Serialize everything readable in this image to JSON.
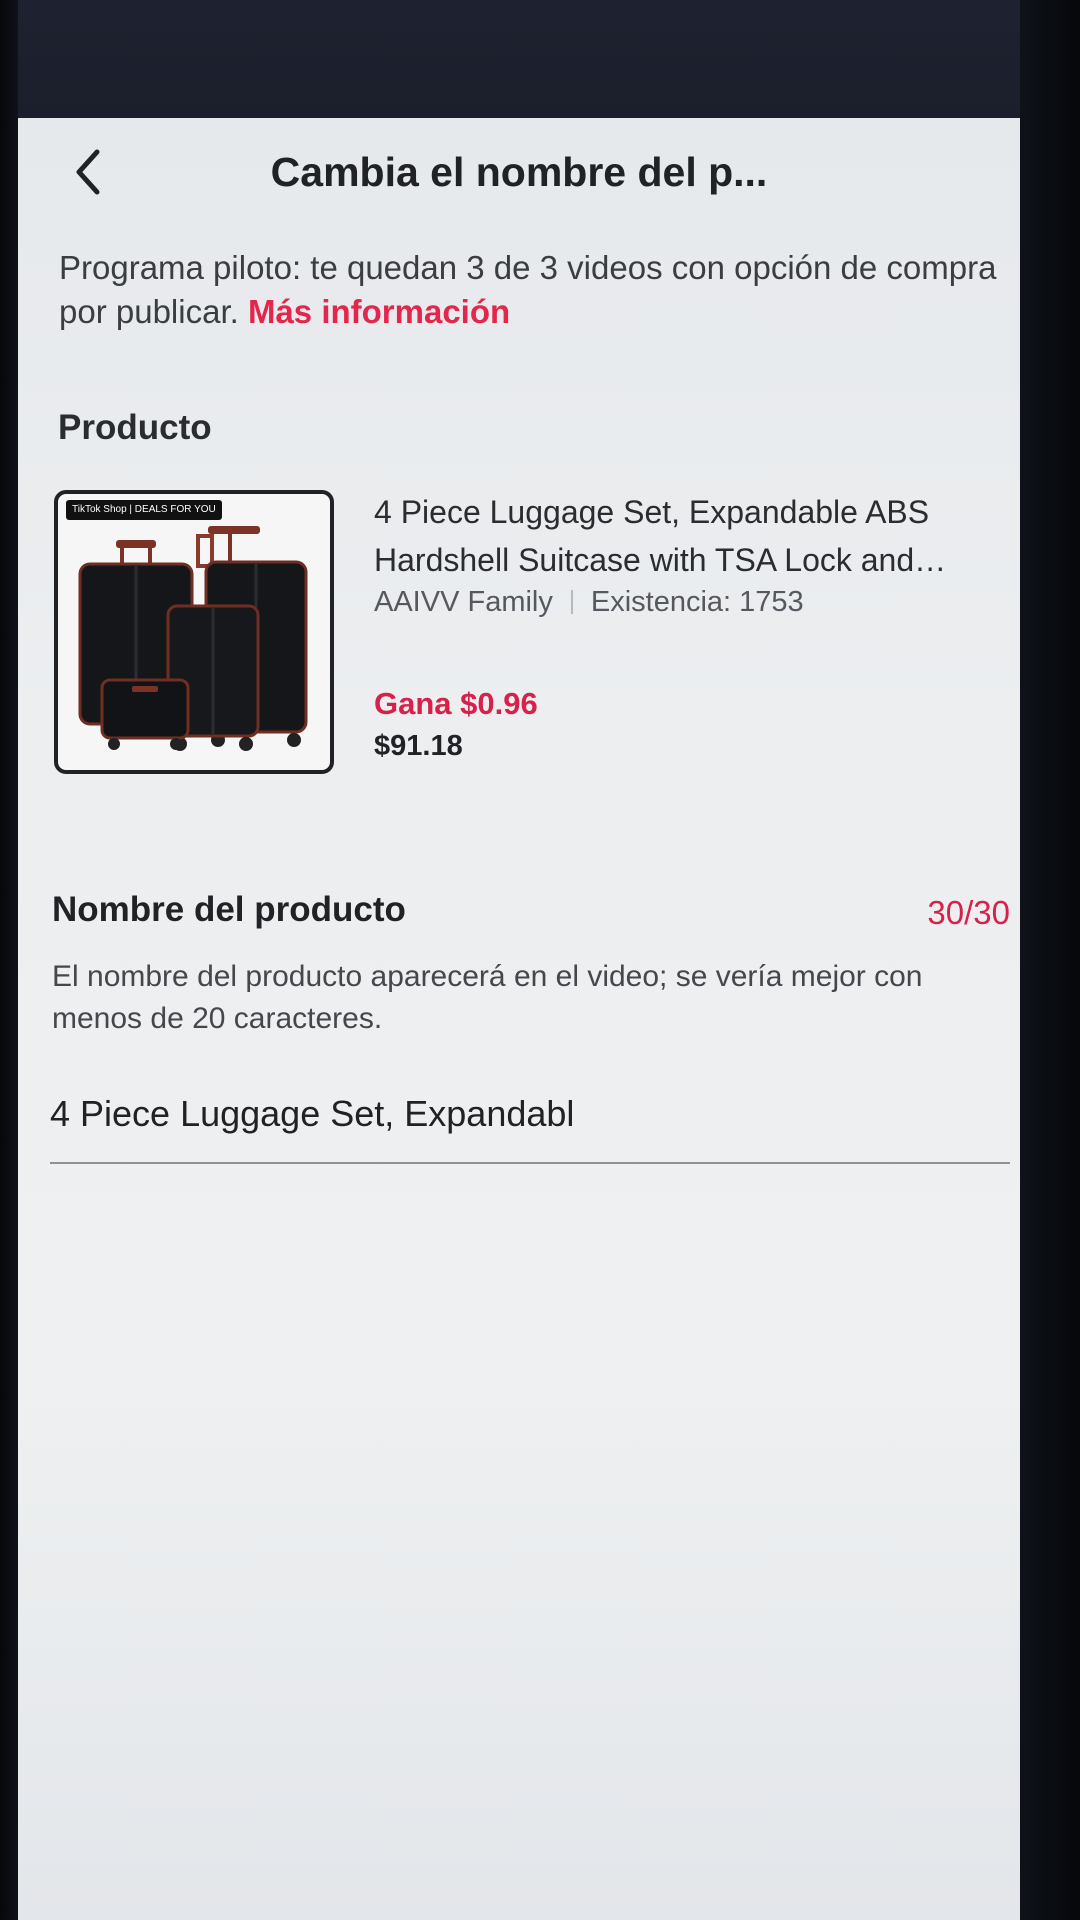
{
  "header": {
    "title": "Cambia el nombre del p...",
    "back_icon": "chevron-left-icon"
  },
  "notice": {
    "text": "Programa piloto: te quedan 3 de 3 videos con opción de compra por publicar. ",
    "link": "Más información",
    "link_color": "#e3264c"
  },
  "product_section": {
    "title": "Producto",
    "thumbnail": {
      "banner": "TikTok Shop | DEALS FOR YOU",
      "image": "luggage-set-image"
    },
    "name": "4 Piece Luggage Set, Expandable ABS Hardshell Suitcase with TSA Lock and…",
    "seller": "AAIVV Family",
    "stock": "Existencia: 1753",
    "earn": "Gana $0.96",
    "price": "$91.18"
  },
  "name_field": {
    "title": "Nombre del producto",
    "counter": "30/30",
    "helper": "El nombre del producto aparecerá en el video; se vería mejor con menos de 20 caracteres.",
    "value": "4 Piece Luggage Set, Expandabl"
  },
  "colors": {
    "accent": "#d8214a",
    "text": "#202226",
    "background": "#eceef0"
  }
}
